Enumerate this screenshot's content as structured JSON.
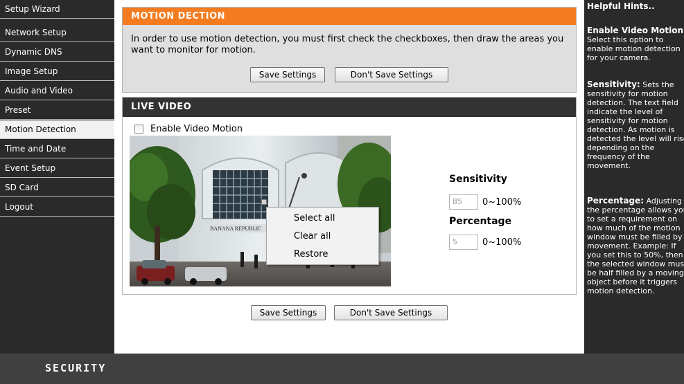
{
  "sidebar": {
    "items": [
      {
        "label": "Setup Wizard"
      },
      {
        "label": "Network Setup"
      },
      {
        "label": "Dynamic DNS"
      },
      {
        "label": "Image Setup"
      },
      {
        "label": "Audio and Video"
      },
      {
        "label": "Preset"
      },
      {
        "label": "Motion Detection",
        "active": true
      },
      {
        "label": "Time and Date"
      },
      {
        "label": "Event Setup"
      },
      {
        "label": "SD Card"
      },
      {
        "label": "Logout"
      }
    ]
  },
  "motion": {
    "title": "MOTION DECTION",
    "description": "In order to use motion detection, you must first check the checkboxes, then draw the areas you want to monitor for motion.",
    "save_label": "Save Settings",
    "dont_save_label": "Don't Save Settings"
  },
  "live": {
    "title": "LIVE VIDEO",
    "enable_label": "Enable Video Motion",
    "enable_checked": false,
    "sensitivity_label": "Sensitivity",
    "sensitivity_value": "85",
    "sensitivity_range": "0~100%",
    "percentage_label": "Percentage",
    "percentage_value": "5",
    "percentage_range": "0~100%",
    "video_sign": "BANANA REPUBLIC"
  },
  "context_menu": {
    "items": [
      "Select all",
      "Clear all",
      "Restore"
    ]
  },
  "bottom": {
    "save_label": "Save Settings",
    "dont_save_label": "Don't Save Settings"
  },
  "help": {
    "title": "Helpful Hints..",
    "enable_heading": "Enable Video Motion:",
    "enable_text": "Select this option to enable motion detection for your camera.",
    "sensitivity_heading": "Sensitivity:",
    "sensitivity_text": "Sets the sensitivity for motion detection. The text field indicate the level of sensitivity for motion detection. As motion is detected the level will rise depending on the frequency of the movement.",
    "percentage_heading": "Percentage:",
    "percentage_text": "Adjusting the percentage allows you to set a requirement on how much of the motion window must be filled by movement. Example: If you set this to 50%, then the selected window must be half filled by a moving object before it triggers motion detection."
  },
  "footer": {
    "brand": "SECURITY"
  },
  "colors": {
    "accent": "#f47b20",
    "sidebar_bg": "#2a2a2a",
    "panel_dark": "#333333"
  }
}
